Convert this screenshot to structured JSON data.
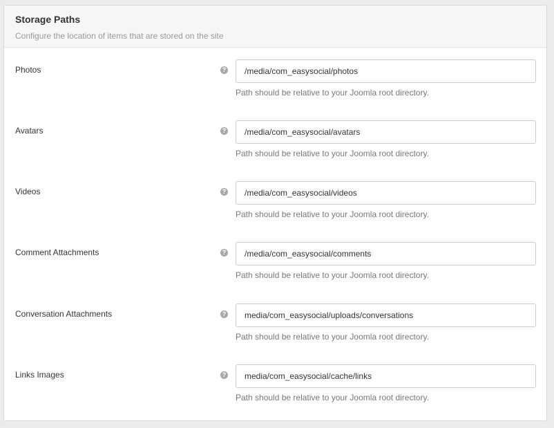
{
  "panel": {
    "title": "Storage Paths",
    "description": "Configure the location of items that are stored on the site"
  },
  "help_icon": "question-circle-icon",
  "fields": [
    {
      "label": "Photos",
      "value": "/media/com_easysocial/photos",
      "hint": "Path should be relative to your Joomla root directory."
    },
    {
      "label": "Avatars",
      "value": "/media/com_easysocial/avatars",
      "hint": "Path should be relative to your Joomla root directory."
    },
    {
      "label": "Videos",
      "value": "/media/com_easysocial/videos",
      "hint": "Path should be relative to your Joomla root directory."
    },
    {
      "label": "Comment Attachments",
      "value": "/media/com_easysocial/comments",
      "hint": "Path should be relative to your Joomla root directory."
    },
    {
      "label": "Conversation Attachments",
      "value": "media/com_easysocial/uploads/conversations",
      "hint": "Path should be relative to your Joomla root directory."
    },
    {
      "label": "Links Images",
      "value": "media/com_easysocial/cache/links",
      "hint": "Path should be relative to your Joomla root directory."
    }
  ]
}
